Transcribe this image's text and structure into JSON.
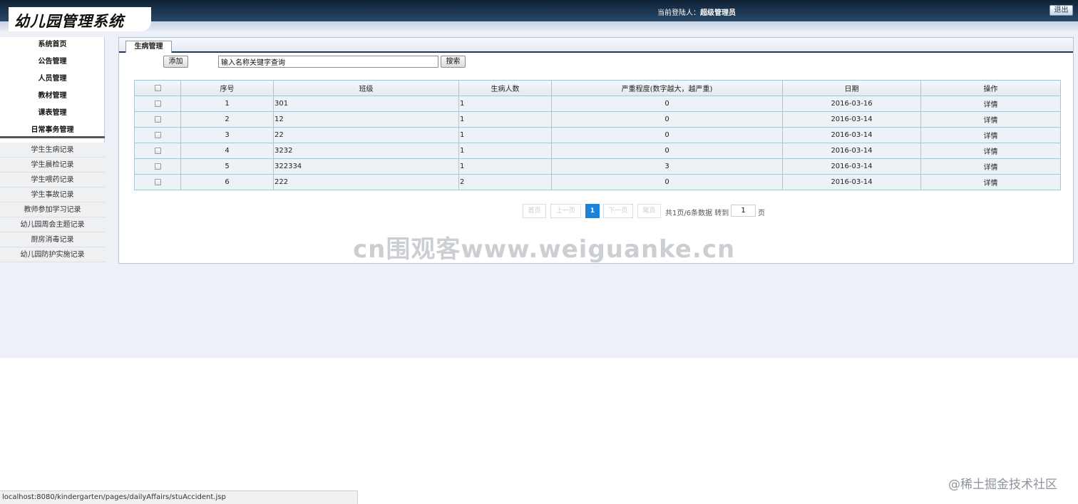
{
  "header": {
    "logo_text": "幼儿园管理系统",
    "login_label": "当前登陆人：",
    "login_user": "超级管理员",
    "logout_label": "退出"
  },
  "sidebar": {
    "items": [
      {
        "label": "系统首页"
      },
      {
        "label": "公告管理"
      },
      {
        "label": "人员管理"
      },
      {
        "label": "教材管理"
      },
      {
        "label": "课表管理"
      },
      {
        "label": "日常事务管理"
      }
    ],
    "sub_items": [
      {
        "label": "学生生病记录"
      },
      {
        "label": "学生晨检记录"
      },
      {
        "label": "学生喂药记录"
      },
      {
        "label": "学生事故记录"
      },
      {
        "label": "教师参加学习记录"
      },
      {
        "label": "幼儿园周会主题记录"
      },
      {
        "label": "厨房消毒记录"
      },
      {
        "label": "幼儿园防护实施记录"
      }
    ]
  },
  "main": {
    "tab_label": "生病管理",
    "add_label": "添加",
    "search_value": "输入名称关键字查询",
    "search_label": "搜索",
    "table": {
      "headers": [
        "序号",
        "班级",
        "生病人数",
        "严重程度(数字越大，越严重)",
        "日期",
        "操作"
      ],
      "rows": [
        {
          "no": "1",
          "class": "301",
          "count": "1",
          "severity": "0",
          "date": "2016-03-16",
          "action": "详情"
        },
        {
          "no": "2",
          "class": "12",
          "count": "1",
          "severity": "0",
          "date": "2016-03-14",
          "action": "详情"
        },
        {
          "no": "3",
          "class": "22",
          "count": "1",
          "severity": "0",
          "date": "2016-03-14",
          "action": "详情"
        },
        {
          "no": "4",
          "class": "3232",
          "count": "1",
          "severity": "0",
          "date": "2016-03-14",
          "action": "详情"
        },
        {
          "no": "5",
          "class": "322334",
          "count": "1",
          "severity": "3",
          "date": "2016-03-14",
          "action": "详情"
        },
        {
          "no": "6",
          "class": "222",
          "count": "2",
          "severity": "0",
          "date": "2016-03-14",
          "action": "详情"
        }
      ]
    },
    "pager": {
      "first": "首页",
      "prev": "上一页",
      "current": "1",
      "next": "下一页",
      "last": "尾页",
      "summary": "共1页/6条数据 转到",
      "goto_value": "1",
      "page_suffix": "页"
    }
  },
  "watermark": "cn围观客www.weiguanke.cn",
  "status_url": "localhost:8080/kindergarten/pages/dailyAffairs/stuAccident.jsp",
  "site_mark": "@稀土掘金技术社区",
  "colors": {
    "header_dark": "#1d3955",
    "accent_blue": "#1b84d8",
    "table_border": "#a9c6d3"
  }
}
